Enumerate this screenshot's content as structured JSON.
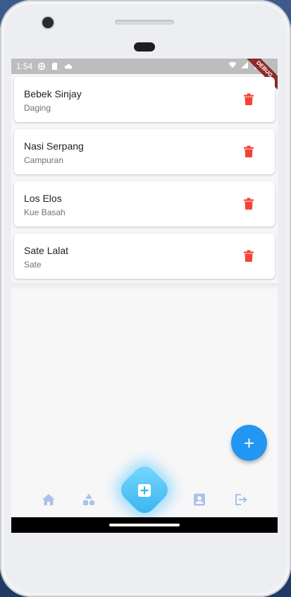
{
  "status_bar": {
    "time": "1:54",
    "debug_label": "DEBUG"
  },
  "items": [
    {
      "name": "Bebek Sinjay",
      "category": "Daging"
    },
    {
      "name": "Nasi Serpang",
      "category": "Campuran"
    },
    {
      "name": "Los Elos",
      "category": "Kue Basah"
    },
    {
      "name": "Sate Lalat",
      "category": "Sate"
    }
  ],
  "fab": {
    "icon": "plus-icon",
    "color": "#2196f3"
  },
  "bottom_nav": {
    "icons": [
      "home-icon",
      "shapes-icon",
      "add-box-icon",
      "contact-card-icon",
      "logout-icon"
    ],
    "accent": "#36b2f0"
  },
  "colors": {
    "delete": "#f44336",
    "nav_icon": "#a9c2e6"
  }
}
